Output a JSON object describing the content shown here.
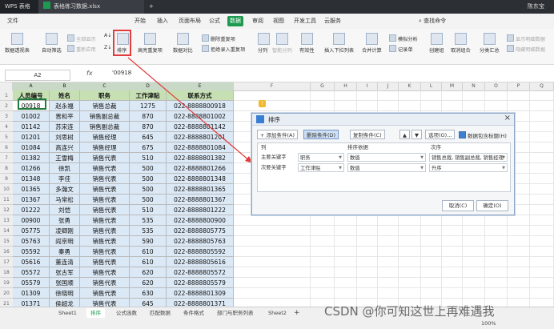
{
  "titlebar": {
    "app": "WPS 表格",
    "file_tab": "表格练习数据.xlsx",
    "new_tab": "+",
    "user": "陈东宝"
  },
  "menubar": {
    "file": "文件",
    "items": [
      "开始",
      "插入",
      "页面布局",
      "公式",
      "数据",
      "审阅",
      "视图",
      "开发工具",
      "云服务"
    ],
    "active": "数据",
    "search": "查找命令"
  },
  "ribbon": {
    "pivot": "数据透视表",
    "autofilter": "自动筛选",
    "show_all": "全部显示",
    "reapply": "重新应用",
    "sort_az": "A↓",
    "sort_za": "Z↓",
    "sort": "排序",
    "highlight_dup": "高亮重复项",
    "data_compare": "数据对比",
    "remove_dup": "删除重复项",
    "reject_dup": "拒绝录入重复项",
    "split": "分列",
    "smart_split": "智能分列",
    "validity": "有效性",
    "dropdown": "插入下拉列表",
    "merge_calc": "合并计算",
    "whatif": "模拟分析",
    "record": "记录单",
    "create_group": "创建组",
    "ungroup": "取消组合",
    "subtotal": "分类汇总",
    "show_detail": "显示明细数据",
    "hide_detail": "隐藏明细数据"
  },
  "formula_bar": {
    "name_box": "A2",
    "fx": "fx",
    "value": "'00918"
  },
  "columns": [
    "A",
    "B",
    "C",
    "D",
    "E",
    "F",
    "G",
    "H",
    "I",
    "J",
    "K",
    "L",
    "M",
    "N",
    "O",
    "P",
    "Q"
  ],
  "rows": [
    "1",
    "2",
    "3",
    "4",
    "5",
    "6",
    "7",
    "8",
    "9",
    "10",
    "11",
    "12",
    "13",
    "14",
    "15",
    "16",
    "17",
    "18",
    "19",
    "20",
    "21"
  ],
  "table": {
    "headers": [
      "人员编号",
      "姓名",
      "职务",
      "工作津贴",
      "联系方式"
    ],
    "rows": [
      [
        "00918",
        "赵永福",
        "销售总裁",
        "1275",
        "022-8888800918"
      ],
      [
        "01002",
        "晋和平",
        "销售副总裁",
        "870",
        "022-8888801002"
      ],
      [
        "01142",
        "苏宋连",
        "销售副总裁",
        "870",
        "022-8888801142"
      ],
      [
        "01201",
        "刘思树",
        "销售经理",
        "645",
        "022-8888801201"
      ],
      [
        "01084",
        "高连兴",
        "销售经理",
        "675",
        "022-8888801084"
      ],
      [
        "01382",
        "王雪梅",
        "销售代表",
        "510",
        "022-8888801382"
      ],
      [
        "01266",
        "徐凯",
        "销售代表",
        "500",
        "022-8888801266"
      ],
      [
        "01348",
        "李佳",
        "销售代表",
        "500",
        "022-8888801348"
      ],
      [
        "01365",
        "多瀚文",
        "销售代表",
        "500",
        "022-8888801365"
      ],
      [
        "01367",
        "马常松",
        "销售代表",
        "500",
        "022-8888801367"
      ],
      [
        "01222",
        "刘恺",
        "销售代表",
        "510",
        "022-8888801222"
      ],
      [
        "00900",
        "张勇",
        "销售代表",
        "535",
        "022-8888800900"
      ],
      [
        "05775",
        "凌卿刚",
        "销售代表",
        "535",
        "022-8888805775"
      ],
      [
        "05763",
        "阎京明",
        "销售代表",
        "590",
        "022-8888805763"
      ],
      [
        "05592",
        "秦勇",
        "销售代表",
        "610",
        "022-8888805592"
      ],
      [
        "05616",
        "董连清",
        "销售代表",
        "610",
        "022-8888805616"
      ],
      [
        "05572",
        "张古军",
        "销售代表",
        "620",
        "022-8888805572"
      ],
      [
        "05579",
        "张国顺",
        "销售代表",
        "620",
        "022-8888805579"
      ],
      [
        "01309",
        "徐晓明",
        "销售代表",
        "630",
        "022-8888801309"
      ],
      [
        "01371",
        "侯超龙",
        "销售代表",
        "645",
        "022-8888801371"
      ],
      [
        "05380",
        "李洪民",
        "销售代表",
        "645",
        "022-8888805380"
      ]
    ]
  },
  "sheets": [
    "Sheet1",
    "排序",
    "公式函数",
    "匹配数据",
    "条件格式",
    "部门与职务列表",
    "Sheet2"
  ],
  "active_sheet": "排序",
  "sheet_add": "+",
  "status": {
    "zoom": "100%",
    "page": "页面布局"
  },
  "watermark": "CSDN @你可知这世上再难遇我",
  "dialog": {
    "title": "排序",
    "add_btn": "+ 添加条件(A)",
    "del_btn": "删除条件(D)",
    "copy_btn": "复制条件(C)",
    "up": "▲",
    "down": "▼",
    "options_btn": "选项(O)...",
    "header_chk": "数据包含标题(H)",
    "col_header": "列",
    "basis_header": "排序依据",
    "order_header": "次序",
    "rows": [
      {
        "label": "主要关键字",
        "column": "职务",
        "basis": "数值",
        "order": "销售总裁, 销售副总裁, 销售经理"
      },
      {
        "label": "次要关键字",
        "column": "工作津贴",
        "basis": "数值",
        "order": "升序"
      }
    ],
    "cancel": "取消(C)",
    "ok": "确定(O)"
  },
  "colors": {
    "accent": "#1e9a50",
    "header_fill": "#c6e0b4",
    "data_fill": "#dbe8f5",
    "callout": "#e23c3c"
  }
}
